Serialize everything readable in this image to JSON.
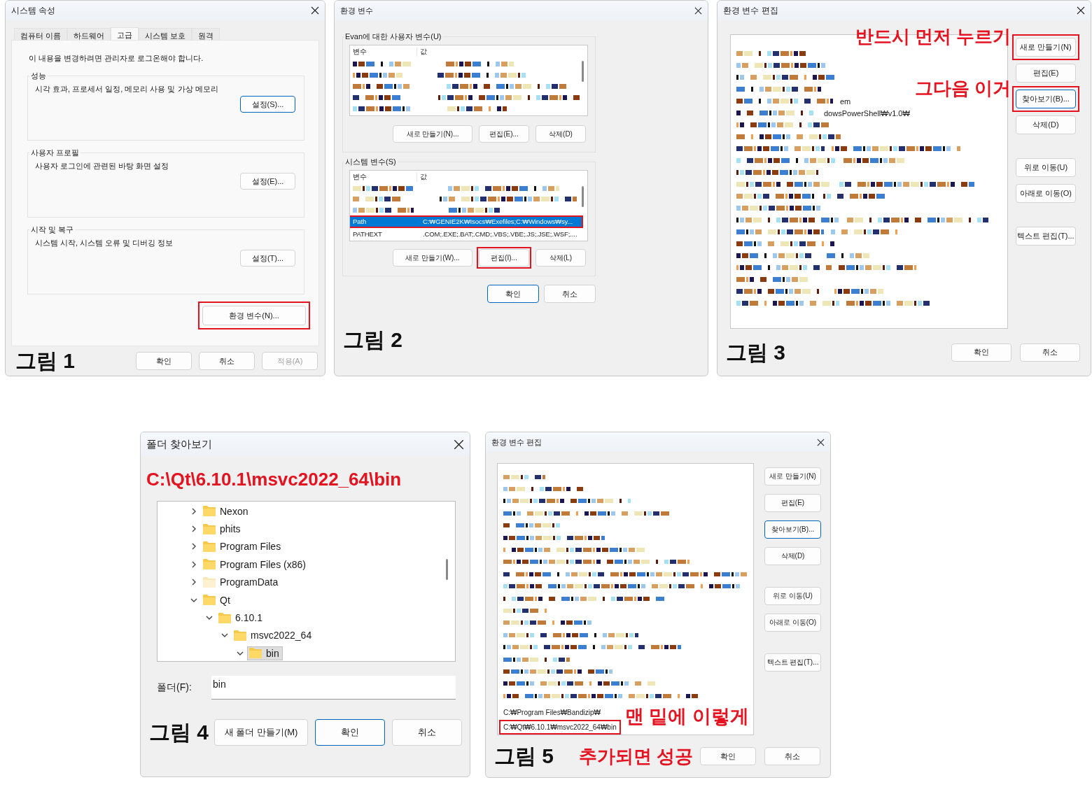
{
  "system_properties": {
    "title": "시스템 속성",
    "tabs": [
      {
        "label": "컴퓨터 이름",
        "selected": false
      },
      {
        "label": "하드웨어",
        "selected": false
      },
      {
        "label": "고급",
        "selected": true
      },
      {
        "label": "시스템 보호",
        "selected": false
      },
      {
        "label": "원격",
        "selected": false
      }
    ],
    "notice": "이 내용을 변경하려면 관리자로 로그온해야 합니다.",
    "groups": [
      {
        "title": "성능",
        "description": "시각 효과, 프로세서 일정, 메모리 사용 및 가상 메모리",
        "button": {
          "label": "설정(S)...",
          "focused": true,
          "highlighted": false
        }
      },
      {
        "title": "사용자 프로필",
        "description": "사용자 로그인에 관련된 바탕 화면 설정",
        "button": {
          "label": "설정(E)...",
          "focused": false,
          "highlighted": false
        }
      },
      {
        "title": "시작 및 복구",
        "description": "시스템 시작, 시스템 오류 및 디버깅 정보",
        "button": {
          "label": "설정(T)...",
          "focused": false,
          "highlighted": false
        }
      }
    ],
    "env_button": {
      "label": "환경 변수(N)...",
      "focused": false,
      "highlighted": true
    },
    "figure_label": "그림 1",
    "buttons": [
      {
        "label": "확인",
        "focused": false,
        "highlighted": false,
        "disabled": false
      },
      {
        "label": "취소",
        "focused": false,
        "highlighted": false,
        "disabled": false
      },
      {
        "label": "적용(A)",
        "focused": false,
        "highlighted": false,
        "disabled": true
      }
    ]
  },
  "environment_variables": {
    "title": "환경 변수",
    "user_group": {
      "title": "Evan에 대한 사용자 변수(U)",
      "columns": [
        "변수",
        "값"
      ],
      "buttons": [
        {
          "label": "새로 만들기(N)...",
          "focused": false,
          "highlighted": false
        },
        {
          "label": "편집(E)...",
          "focused": false,
          "highlighted": false
        },
        {
          "label": "삭제(D)",
          "focused": false,
          "highlighted": false
        }
      ]
    },
    "system_group": {
      "title": "시스템 변수(S)",
      "columns": [
        "변수",
        "값"
      ],
      "rows": [
        {
          "name": "Path",
          "value": "C:₩GENIE2K₩Isocs₩Exefiles;C:₩Windows₩sy...",
          "selected": true,
          "highlighted": true
        },
        {
          "name": "PATHEXT",
          "value": ".COM;.EXE;.BAT;.CMD;.VBS;.VBE;.JS;.JSE;.WSF;....",
          "selected": false,
          "highlighted": false
        }
      ],
      "buttons": [
        {
          "label": "새로 만들기(W)...",
          "focused": false,
          "highlighted": false
        },
        {
          "label": "편집(I)...",
          "focused": false,
          "highlighted": true
        },
        {
          "label": "삭제(L)",
          "focused": false,
          "highlighted": false
        }
      ]
    },
    "buttons": [
      {
        "label": "확인",
        "focused": true,
        "highlighted": false
      },
      {
        "label": "취소",
        "focused": false,
        "highlighted": false
      }
    ],
    "figure_label": "그림 2"
  },
  "edit_variable": {
    "title": "환경 변수 편집",
    "fragments": [
      "em",
      "dowsPowerShell₩v1.0₩"
    ],
    "side_buttons": [
      {
        "label": "새로 만들기(N)",
        "focused": false,
        "highlighted": true,
        "annotation": "반드시 먼저 누르기"
      },
      {
        "label": "편집(E)",
        "focused": false,
        "highlighted": false
      },
      {
        "label": "찾아보기(B)...",
        "focused": true,
        "highlighted": true,
        "annotation": "그다음 이거"
      },
      {
        "label": "삭제(D)",
        "focused": false,
        "highlighted": false
      },
      {
        "label": "위로 이동(U)",
        "focused": false,
        "highlighted": false
      },
      {
        "label": "아래로 이동(O)",
        "focused": false,
        "highlighted": false
      },
      {
        "label": "텍스트 편집(T)...",
        "focused": false,
        "highlighted": false
      }
    ],
    "buttons": [
      {
        "label": "확인",
        "focused": false,
        "highlighted": false
      },
      {
        "label": "취소",
        "focused": false,
        "highlighted": false
      }
    ],
    "figure_label": "그림 3"
  },
  "browse_folder": {
    "title": "폴더 찾아보기",
    "annotation": "C:\\Qt\\6.10.1\\msvc2022_64\\bin",
    "tree": [
      {
        "label": "Nexon",
        "expanded": false,
        "selected": false,
        "faded": false
      },
      {
        "label": "phits",
        "expanded": false,
        "selected": false,
        "faded": false
      },
      {
        "label": "Program Files",
        "expanded": false,
        "selected": false,
        "faded": false
      },
      {
        "label": "Program Files (x86)",
        "expanded": false,
        "selected": false,
        "faded": false
      },
      {
        "label": "ProgramData",
        "expanded": false,
        "selected": false,
        "faded": true
      },
      {
        "label": "Qt",
        "expanded": true,
        "selected": false,
        "faded": false,
        "children": [
          {
            "label": "6.10.1",
            "expanded": true,
            "selected": false,
            "faded": false,
            "children": [
              {
                "label": "msvc2022_64",
                "expanded": true,
                "selected": false,
                "faded": false,
                "children": [
                  {
                    "label": "bin",
                    "expanded": true,
                    "selected": true,
                    "faded": false
                  }
                ]
              }
            ]
          }
        ]
      }
    ],
    "folder_label": "폴더(F):",
    "folder_value": "bin",
    "buttons": [
      {
        "label": "새 폴더 만들기(M)",
        "focused": false,
        "highlighted": false
      },
      {
        "label": "확인",
        "focused": true,
        "highlighted": false
      },
      {
        "label": "취소",
        "focused": false,
        "highlighted": false
      }
    ],
    "figure_label": "그림 4"
  },
  "edit_variable_result": {
    "title": "환경 변수 편집",
    "entries": [
      {
        "text": "C:₩Program Files₩Bandizip₩",
        "highlighted": false
      },
      {
        "text": "C:₩Qt₩6.10.1₩msvc2022_64₩bin",
        "highlighted": true
      }
    ],
    "list_annotation": "맨 밑에 이렇게",
    "side_buttons": [
      {
        "label": "새로 만들기(N)",
        "focused": false,
        "highlighted": false
      },
      {
        "label": "편집(E)",
        "focused": false,
        "highlighted": false
      },
      {
        "label": "찾아보기(B)...",
        "focused": true,
        "highlighted": false
      },
      {
        "label": "삭제(D)",
        "focused": false,
        "highlighted": false
      },
      {
        "label": "위로 이동(U)",
        "focused": false,
        "highlighted": false
      },
      {
        "label": "아래로 이동(O)",
        "focused": false,
        "highlighted": false
      },
      {
        "label": "텍스트 편집(T)...",
        "focused": false,
        "highlighted": false
      }
    ],
    "footer_annotation": "추가되면 성공",
    "buttons": [
      {
        "label": "확인",
        "focused": false,
        "highlighted": false
      },
      {
        "label": "취소",
        "focused": false,
        "highlighted": false
      }
    ],
    "figure_label": "그림 5"
  }
}
